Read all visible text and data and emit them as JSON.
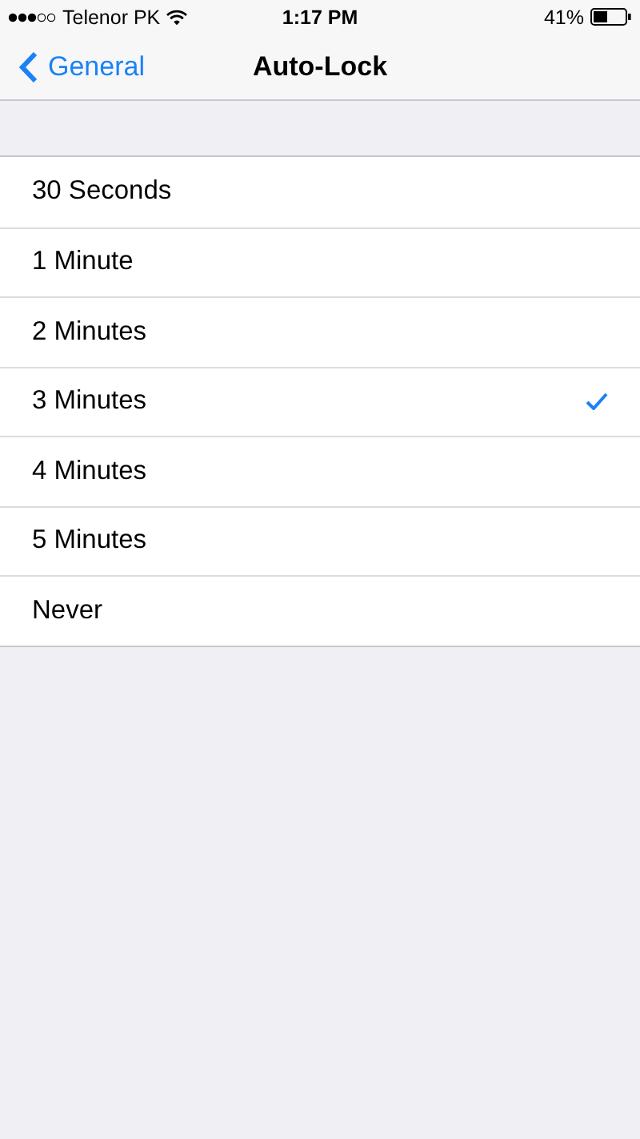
{
  "status_bar": {
    "carrier": "Telenor PK",
    "time": "1:17 PM",
    "battery": "41%"
  },
  "nav": {
    "back": "General",
    "title": "Auto-Lock"
  },
  "options": [
    {
      "label": "30 Seconds",
      "selected": false
    },
    {
      "label": "1 Minute",
      "selected": false
    },
    {
      "label": "2 Minutes",
      "selected": false
    },
    {
      "label": "3 Minutes",
      "selected": true
    },
    {
      "label": "4 Minutes",
      "selected": false
    },
    {
      "label": "5 Minutes",
      "selected": false
    },
    {
      "label": "Never",
      "selected": false
    }
  ]
}
